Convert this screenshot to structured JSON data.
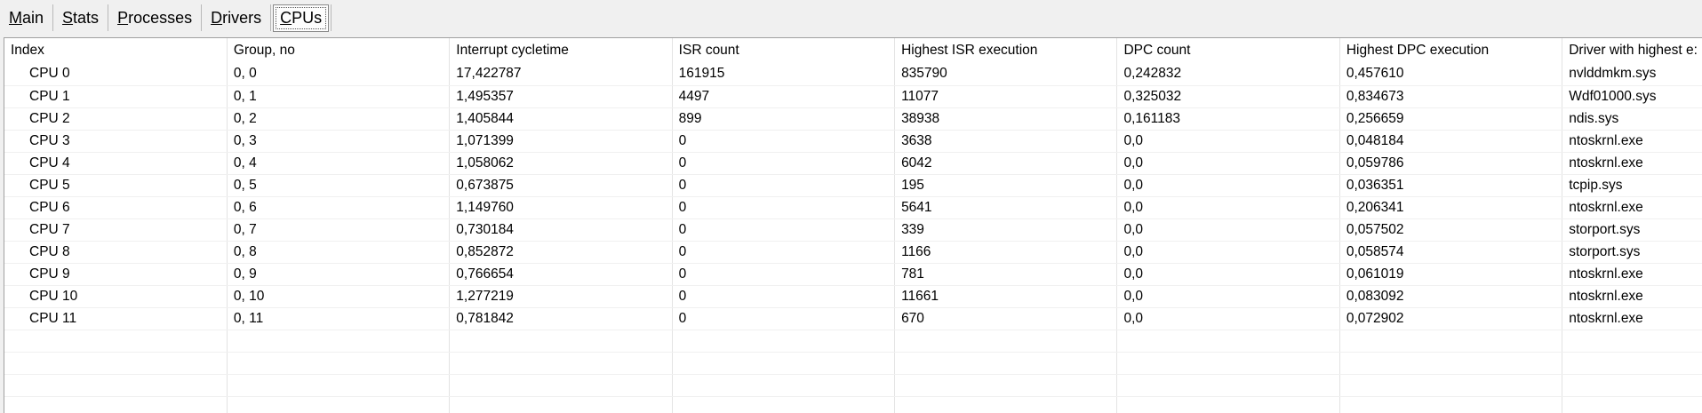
{
  "tabs": [
    {
      "first": "M",
      "rest": "ain"
    },
    {
      "first": "S",
      "rest": "tats"
    },
    {
      "first": "P",
      "rest": "rocesses"
    },
    {
      "first": "D",
      "rest": "rivers"
    },
    {
      "first": "C",
      "rest": "PUs"
    }
  ],
  "active_tab": "CPUs",
  "table": {
    "columns": [
      "Index",
      "Group, no",
      "Interrupt cycletime",
      "ISR count",
      "Highest ISR execution",
      "DPC count",
      "Highest DPC execution",
      "Driver with highest e:"
    ],
    "rows": [
      [
        "CPU 0",
        "0, 0",
        "17,422787",
        "161915",
        "835790",
        "0,242832",
        "0,457610",
        "nvlddmkm.sys"
      ],
      [
        "CPU 1",
        "0, 1",
        "1,495357",
        "4497",
        "11077",
        "0,325032",
        "0,834673",
        "Wdf01000.sys"
      ],
      [
        "CPU 2",
        "0, 2",
        "1,405844",
        "899",
        "38938",
        "0,161183",
        "0,256659",
        "ndis.sys"
      ],
      [
        "CPU 3",
        "0, 3",
        "1,071399",
        "0",
        "3638",
        "0,0",
        "0,048184",
        "ntoskrnl.exe"
      ],
      [
        "CPU 4",
        "0, 4",
        "1,058062",
        "0",
        "6042",
        "0,0",
        "0,059786",
        "ntoskrnl.exe"
      ],
      [
        "CPU 5",
        "0, 5",
        "0,673875",
        "0",
        "195",
        "0,0",
        "0,036351",
        "tcpip.sys"
      ],
      [
        "CPU 6",
        "0, 6",
        "1,149760",
        "0",
        "5641",
        "0,0",
        "0,206341",
        "ntoskrnl.exe"
      ],
      [
        "CPU 7",
        "0, 7",
        "0,730184",
        "0",
        "339",
        "0,0",
        "0,057502",
        "storport.sys"
      ],
      [
        "CPU 8",
        "0, 8",
        "0,852872",
        "0",
        "1166",
        "0,0",
        "0,058574",
        "storport.sys"
      ],
      [
        "CPU 9",
        "0, 9",
        "0,766654",
        "0",
        "781",
        "0,0",
        "0,061019",
        "ntoskrnl.exe"
      ],
      [
        "CPU 10",
        "0, 10",
        "1,277219",
        "0",
        "11661",
        "0,0",
        "0,083092",
        "ntoskrnl.exe"
      ],
      [
        "CPU 11",
        "0, 11",
        "0,781842",
        "0",
        "670",
        "0,0",
        "0,072902",
        "ntoskrnl.exe"
      ]
    ]
  }
}
